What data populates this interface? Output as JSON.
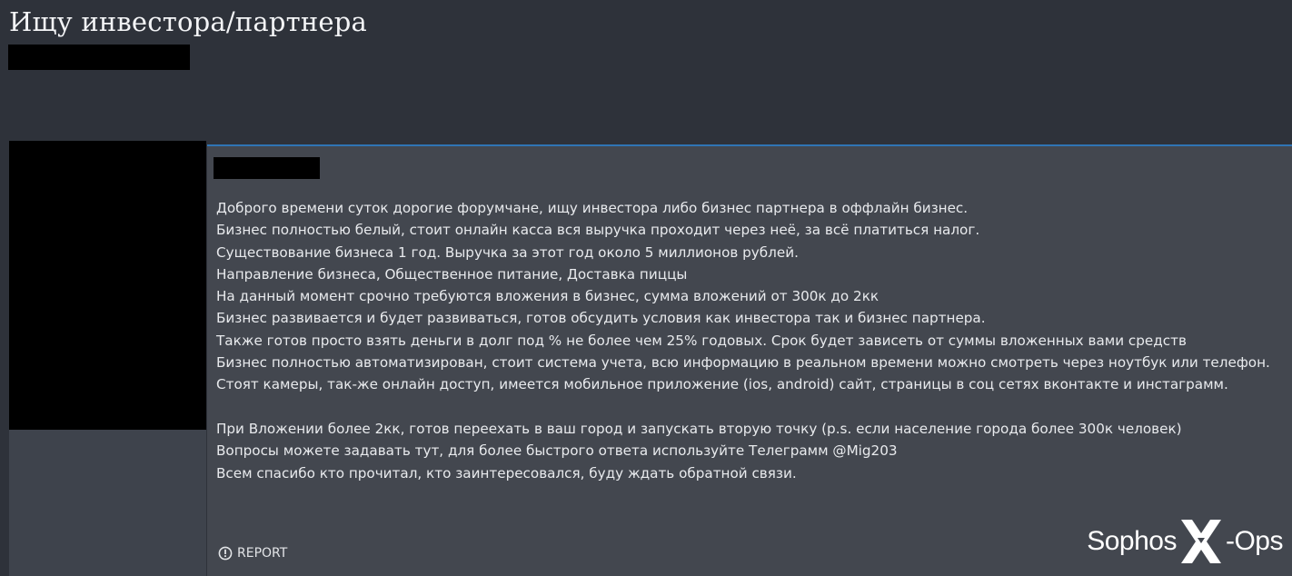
{
  "thread": {
    "title": "Ищу инвестора/партнера"
  },
  "post": {
    "lines": [
      "Доброго времени суток дорогие форумчане, ищу инвестора либо бизнес партнера в оффлайн бизнес.",
      "Бизнес полностью белый, стоит онлайн касса вся выручка проходит через неё, за всё платиться налог.",
      "Существование бизнеса 1 год. Выручка за этот год около 5 миллионов рублей.",
      "Направление бизнеса, Общественное питание, Доставка пиццы",
      "На данный момент срочно требуются вложения в бизнес, сумма вложений от 300к до 2кк",
      "Бизнес развивается и будет развиваться, готов обсудить условия как инвестора так и бизнес партнера.",
      "Также готов просто взять деньги в долг под % не более чем 25% годовых. Срок будет зависеть от суммы вложенных вами средств",
      "Бизнес полностью автоматизирован, стоит система учета, всю информацию в реальном времени можно смотреть через ноутбук или телефон.",
      "Стоят камеры, так-же онлайн доступ, имеется мобильное приложение (ios, android) сайт, страницы в соц сетях вконтакте и инстаграмм.",
      "",
      "При Вложении более 2кк, готов переехать в ваш город и запускать вторую точку (p.s. если население города более 300к человек)",
      "Вопросы можете задавать тут, для более быстрого ответа используйте Телеграмм @Mig203",
      "Всем спасибо кто прочитал, кто заинтересовался, буду ждать обратной связи."
    ],
    "report_label": "REPORT"
  },
  "watermark": {
    "left": "Sophos",
    "right": "-Ops"
  },
  "icons": {
    "report": "alert-circle-icon",
    "watermark_x": "x-mark-icon"
  },
  "colors": {
    "accent": "#2f74b5",
    "page_bg": "#2e323a",
    "post_bg": "#43474f"
  }
}
